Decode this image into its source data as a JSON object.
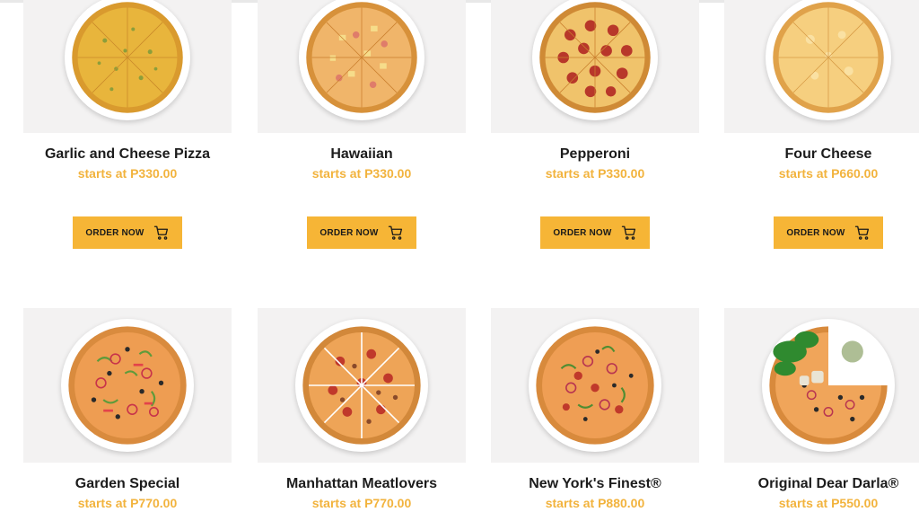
{
  "products": [
    {
      "name": "Garlic and Cheese Pizza",
      "price": "starts at P330.00",
      "button": "ORDER NOW",
      "image": "garlic-cheese-pizza-image"
    },
    {
      "name": "Hawaiian",
      "price": "starts at P330.00",
      "button": "ORDER NOW",
      "image": "hawaiian-pizza-image"
    },
    {
      "name": "Pepperoni",
      "price": "starts at P330.00",
      "button": "ORDER NOW",
      "image": "pepperoni-pizza-image"
    },
    {
      "name": "Four Cheese",
      "price": "starts at P660.00",
      "button": "ORDER NOW",
      "image": "four-cheese-pizza-image"
    },
    {
      "name": "Garden Special",
      "price": "starts at P770.00",
      "image": "garden-special-pizza-image"
    },
    {
      "name": "Manhattan Meatlovers",
      "price": "starts at P770.00",
      "image": "manhattan-meatlovers-pizza-image"
    },
    {
      "name": "New York's Finest®",
      "price": "starts at P880.00",
      "image": "new-yorks-finest-pizza-image"
    },
    {
      "name": "Original Dear Darla®",
      "price": "starts at P550.00",
      "image": "original-dear-darla-pizza-image"
    }
  ],
  "colors": {
    "accent": "#f6b536",
    "price": "#f2b33d",
    "title": "#1c1c1c"
  }
}
